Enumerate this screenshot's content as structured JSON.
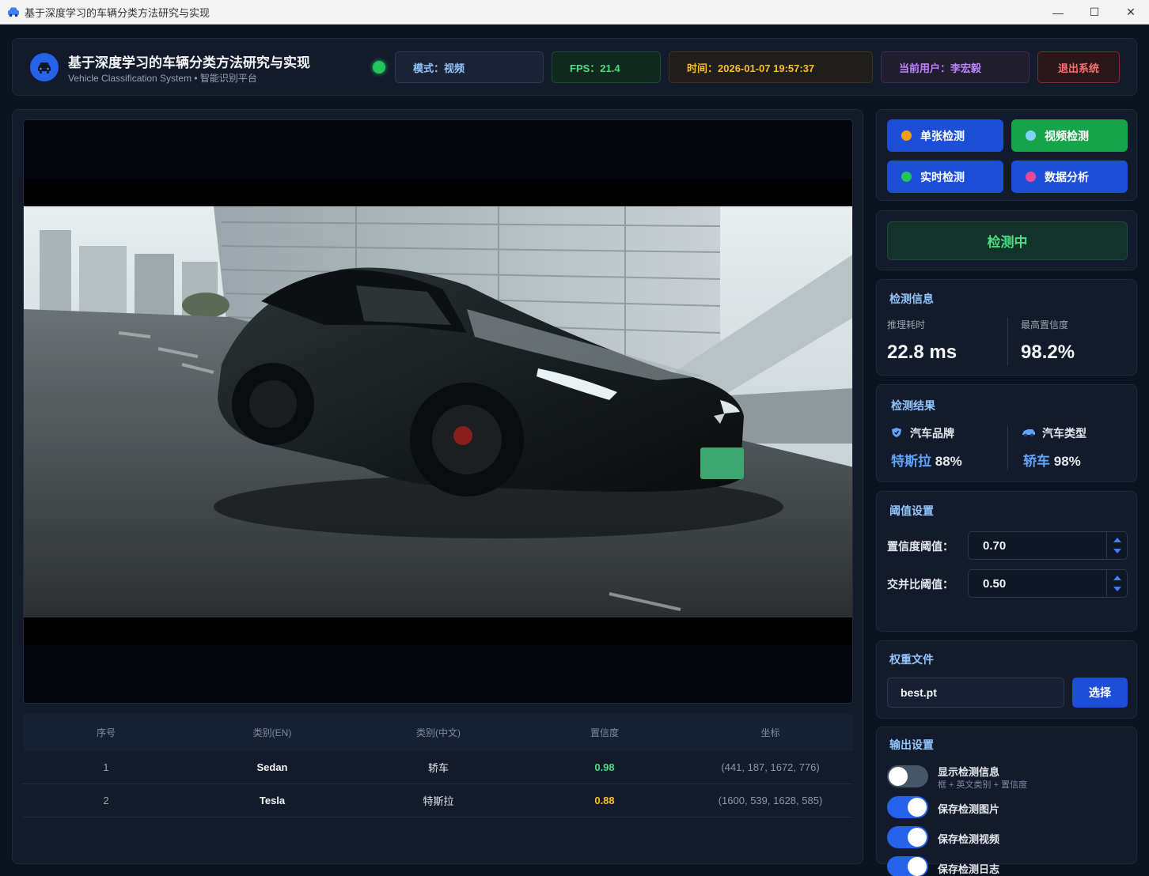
{
  "window": {
    "title": "基于深度学习的车辆分类方法研究与实现",
    "minimize": "—",
    "maximize": "☐",
    "close": "✕"
  },
  "header": {
    "title": "基于深度学习的车辆分类方法研究与实现",
    "subtitle": "Vehicle Classification System • 智能识别平台",
    "mode": "模式：视频",
    "fps": "FPS：21.4",
    "time": "时间：2026-01-07 19:57:37",
    "user": "当前用户：李宏毅",
    "logout": "退出系统",
    "status_color": "#22c55e"
  },
  "modes": [
    {
      "label": "单张检测",
      "dot": "#f59e0b",
      "active": false
    },
    {
      "label": "视频检测",
      "dot": "#7dd3fc",
      "active": true
    },
    {
      "label": "实时检测",
      "dot": "#22c55e",
      "active": false
    },
    {
      "label": "数据分析",
      "dot": "#ec4899",
      "active": false
    }
  ],
  "status": {
    "label": "检测中"
  },
  "info": {
    "title": "检测信息",
    "latency_label": "推理耗时",
    "latency_value": "22.8 ms",
    "confidence_label": "最高置信度",
    "confidence_value": "98.2%"
  },
  "result": {
    "title": "检测结果",
    "brand_label": "汽车品牌",
    "brand_name": "特斯拉",
    "brand_pct": "88%",
    "type_label": "汽车类型",
    "type_name": "轿车",
    "type_pct": "98%"
  },
  "threshold": {
    "title": "阈值设置",
    "conf_label": "置信度阈值：",
    "conf_value": "0.70",
    "iou_label": "交并比阈值：",
    "iou_value": "0.50"
  },
  "weights": {
    "title": "权重文件",
    "file": "best.pt",
    "choose": "选择"
  },
  "output": {
    "title": "输出设置",
    "items": [
      {
        "label": "显示检测信息",
        "sub": "框 + 英文类别 + 置信度",
        "on": false
      },
      {
        "label": "保存检测图片",
        "sub": "",
        "on": true
      },
      {
        "label": "保存检测视频",
        "sub": "",
        "on": true
      },
      {
        "label": "保存检测日志",
        "sub": "",
        "on": true
      }
    ]
  },
  "table": {
    "headers": [
      "序号",
      "类别(EN)",
      "类别(中文)",
      "置信度",
      "坐标"
    ],
    "rows": [
      {
        "idx": "1",
        "en": "Sedan",
        "cn": "轿车",
        "conf": "0.98",
        "coords": "(441, 187, 1672, 776)",
        "conf_color": "#4ade80"
      },
      {
        "idx": "2",
        "en": "Tesla",
        "cn": "特斯拉",
        "conf": "0.88",
        "coords": "(1600, 539, 1628, 585)",
        "conf_color": "#fbbf24"
      }
    ]
  },
  "icons": {
    "app": "car-icon",
    "logo": "car-icon",
    "brand": "shield-icon",
    "type": "car-side-icon"
  }
}
